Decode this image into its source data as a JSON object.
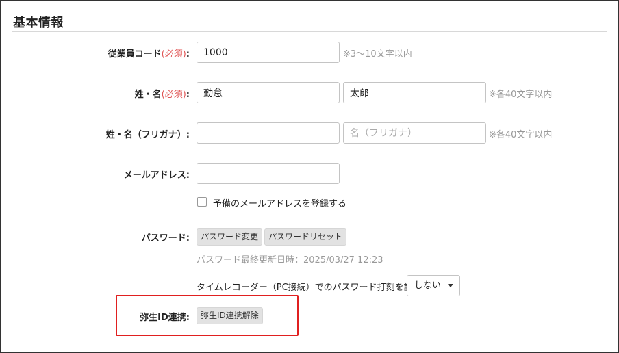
{
  "section": {
    "title": "基本情報"
  },
  "fields": {
    "employee_code": {
      "label": "従業員コード",
      "required": "(必須)",
      "colon": ":",
      "value": "1000",
      "hint": "※3〜10文字以内"
    },
    "name": {
      "label": "姓・名",
      "required": "(必須)",
      "colon": ":",
      "last": "勤怠",
      "first": "太郎",
      "hint": "※各40文字以内"
    },
    "name_kana": {
      "label": "姓・名（フリガナ）:",
      "last_value": "",
      "first_placeholder": "名（フリガナ）",
      "hint": "※各40文字以内"
    },
    "email": {
      "label": "メールアドレス:",
      "value": "",
      "spare_checkbox_label": "予備のメールアドレスを登録する"
    },
    "password": {
      "label": "パスワード:",
      "change_button": "パスワード変更",
      "reset_button": "パスワードリセット",
      "last_updated": "パスワード最終更新日時：2025/03/27 12:23",
      "time_recorder_label": "タイムレコーダー（PC接続）でのパスワード打刻を許可",
      "time_recorder_value": "しない"
    },
    "yayoi": {
      "label": "弥生ID連携:",
      "unlink_button": "弥生ID連携解除"
    }
  },
  "colors": {
    "required": "#e05555",
    "highlight": "#e02020",
    "hint": "#999999"
  }
}
